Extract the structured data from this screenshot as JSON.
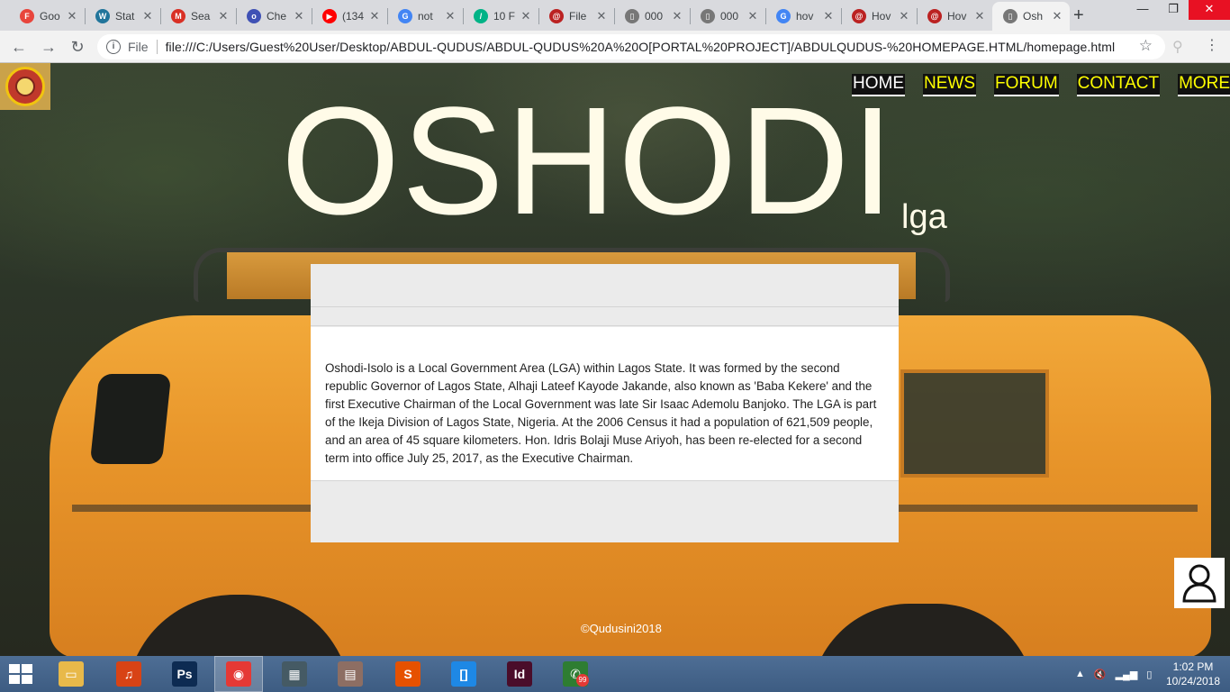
{
  "browser": {
    "tabs": [
      {
        "label": "Goo",
        "favicon": "red-circle-icon",
        "color": "#e8453c",
        "glyph": "F"
      },
      {
        "label": "Stat",
        "favicon": "wordpress-icon",
        "color": "#21759b",
        "glyph": "W"
      },
      {
        "label": "Sea",
        "favicon": "gmail-icon",
        "color": "#d93025",
        "glyph": "M"
      },
      {
        "label": "Che",
        "favicon": "circle-blue-icon",
        "color": "#3f51b5",
        "glyph": "o"
      },
      {
        "label": "(134",
        "favicon": "youtube-icon",
        "color": "#ff0000",
        "glyph": "▶"
      },
      {
        "label": "not",
        "favicon": "google-icon",
        "color": "#4285f4",
        "glyph": "G"
      },
      {
        "label": "10 F",
        "favicon": "green-square-icon",
        "color": "#00b386",
        "glyph": "/"
      },
      {
        "label": "File",
        "favicon": "spiral-icon",
        "color": "#b22",
        "glyph": "@"
      },
      {
        "label": "000",
        "favicon": "document-icon",
        "color": "#777",
        "glyph": "▯"
      },
      {
        "label": "000",
        "favicon": "document-icon",
        "color": "#777",
        "glyph": "▯"
      },
      {
        "label": "hov",
        "favicon": "google-icon",
        "color": "#4285f4",
        "glyph": "G"
      },
      {
        "label": "Hov",
        "favicon": "spiral-icon",
        "color": "#b22",
        "glyph": "@"
      },
      {
        "label": "Hov",
        "favicon": "spiral-icon",
        "color": "#b22",
        "glyph": "@"
      },
      {
        "label": "Osh",
        "favicon": "document-icon",
        "color": "#777",
        "glyph": "▯",
        "active": true
      }
    ],
    "new_tab": "+",
    "window_controls": {
      "minimize": "—",
      "restore": "❐",
      "close": "✕"
    },
    "address": {
      "scheme": "File",
      "url": "file:///C:/Users/Guest%20User/Desktop/ABDUL-QUDUS/ABDUL-QUDUS%20A%20O[PORTAL%20PROJECT]/ABDULQUDUS-%20HOMEPAGE.HTML/homepage.html"
    }
  },
  "page": {
    "nav": {
      "home": "HOME",
      "news": "NEWS",
      "forum": "FORUM",
      "contact": "CONTACT",
      "more": "MORE"
    },
    "title": "OSHODI",
    "subtitle": "lga",
    "body_text": "Oshodi-Isolo is a Local Government Area (LGA) within Lagos State. It was formed by the second republic Governor of Lagos State, Alhaji Lateef Kayode Jakande, also known as 'Baba Kekere' and the first Executive Chairman of the Local Government was late Sir Isaac Ademolu Banjoko. The LGA is part of the Ikeja Division of Lagos State, Nigeria. At the 2006 Census it had a population of 621,509 people, and an area of 45 square kilometers. Hon. Idris Bolaji Muse Ariyoh, has been re-elected for a second term into office July 25, 2017, as the Executive Chairman.",
    "copyright": "©Qudusini2018",
    "colors": {
      "nav_active": "#ffffff",
      "nav_link": "#ffff00",
      "title": "#fffbe8"
    }
  },
  "taskbar": {
    "apps": [
      {
        "name": "file-explorer-icon",
        "color": "#e8b94a",
        "glyph": "▭"
      },
      {
        "name": "music-player-icon",
        "color": "#d84315",
        "glyph": "♫"
      },
      {
        "name": "photoshop-icon",
        "color": "#0d2b52",
        "glyph": "Ps"
      },
      {
        "name": "chrome-icon",
        "color": "#e53935",
        "glyph": "◉",
        "active": true
      },
      {
        "name": "calculator-icon",
        "color": "#455a64",
        "glyph": "▦"
      },
      {
        "name": "reader-icon",
        "color": "#8d6e63",
        "glyph": "▤"
      },
      {
        "name": "sublime-text-icon",
        "color": "#e65100",
        "glyph": "S"
      },
      {
        "name": "brackets-icon",
        "color": "#1e88e5",
        "glyph": "[]"
      },
      {
        "name": "indesign-icon",
        "color": "#4a0d2a",
        "glyph": "Id"
      },
      {
        "name": "whatsapp-icon",
        "color": "#2e7d32",
        "glyph": "✆"
      }
    ],
    "whatsapp_badge": "99",
    "clock_time": "1:02 PM",
    "clock_date": "10/24/2018"
  }
}
